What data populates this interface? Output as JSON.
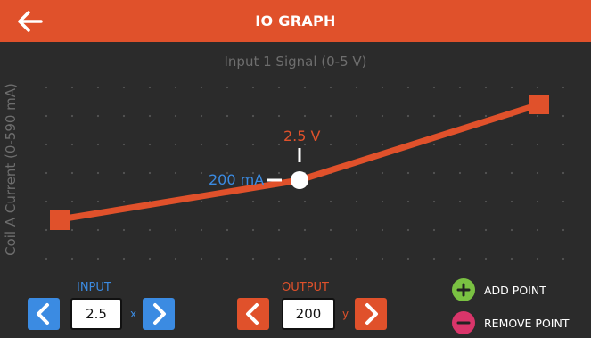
{
  "header": {
    "title": "IO GRAPH",
    "back_icon": "arrow-left-icon"
  },
  "graph": {
    "x_axis_label": "Input 1 Signal (0-5 V)",
    "y_axis_label": "Coil A Current (0-590 mA)",
    "selected_input_label": "2.5 V",
    "selected_output_label": "200 mA",
    "line_color": "#e0512b"
  },
  "input": {
    "label": "INPUT",
    "value": "2.5",
    "suffix": "x",
    "color": "#3b8be2"
  },
  "output": {
    "label": "OUTPUT",
    "value": "200",
    "suffix": "y",
    "color": "#e0512b"
  },
  "actions": {
    "add_point": "ADD POINT",
    "remove_point": "REMOVE POINT"
  }
}
